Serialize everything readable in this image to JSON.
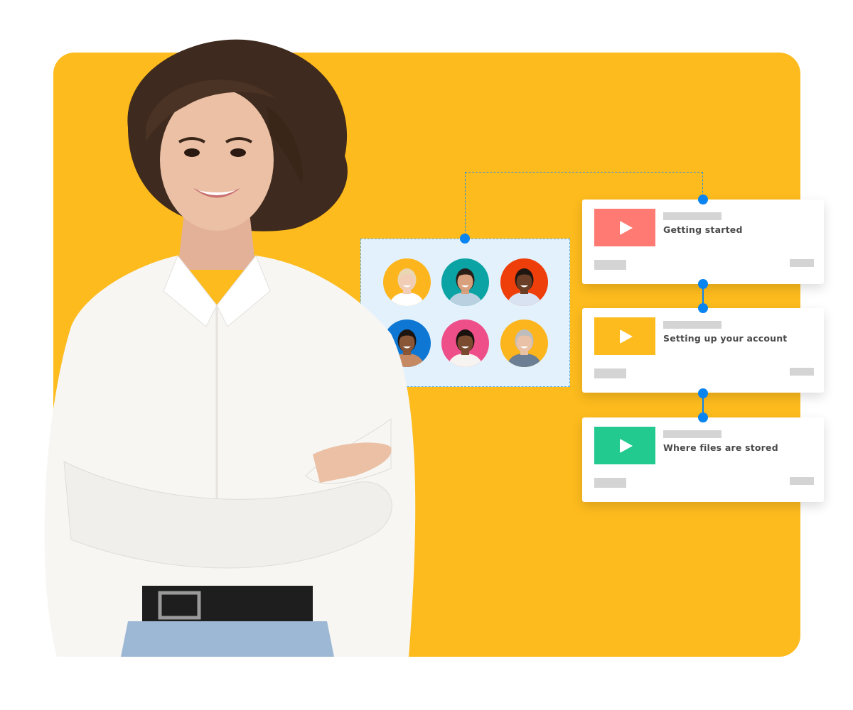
{
  "colors": {
    "panel": "#FDBB1D",
    "connector": "#0A84F0",
    "group_card_bg": "#E2F1FC"
  },
  "hero": {
    "description": "Smiling woman with short brown hair in white shirt, arms crossed"
  },
  "group": {
    "avatars": [
      {
        "name": "avatar-blonde-woman",
        "bg": "#FDB51E",
        "skin": "#F2CDB5",
        "hair": "#E9D6B3",
        "shirt": "#FFFFFF"
      },
      {
        "name": "avatar-smiling-man",
        "bg": "#0BA3A3",
        "skin": "#D9A07E",
        "hair": "#2B1E17",
        "shirt": "#B8D0E0"
      },
      {
        "name": "avatar-older-man",
        "bg": "#EE3F0A",
        "skin": "#6B3F27",
        "hair": "#1F1612",
        "shirt": "#D8E2F0"
      },
      {
        "name": "avatar-young-woman",
        "bg": "#0E77D3",
        "skin": "#8A5638",
        "hair": "#1D1410",
        "shirt": "#C58A63"
      },
      {
        "name": "avatar-bearded-man",
        "bg": "#EE4F88",
        "skin": "#7B4B30",
        "hair": "#1A120E",
        "shirt": "#F6F3F0"
      },
      {
        "name": "avatar-grey-haired-woman",
        "bg": "#FDB51E",
        "skin": "#E8C1A6",
        "hair": "#BDBDBD",
        "shirt": "#6B7E94"
      }
    ]
  },
  "lessons": [
    {
      "title": "Getting started",
      "thumb_color": "#FF7A72",
      "icon": "play-icon"
    },
    {
      "title": "Setting up your account",
      "thumb_color": "#FDBB1D",
      "icon": "play-icon"
    },
    {
      "title": "Where files are stored",
      "thumb_color": "#22CA8F",
      "icon": "play-icon"
    }
  ]
}
